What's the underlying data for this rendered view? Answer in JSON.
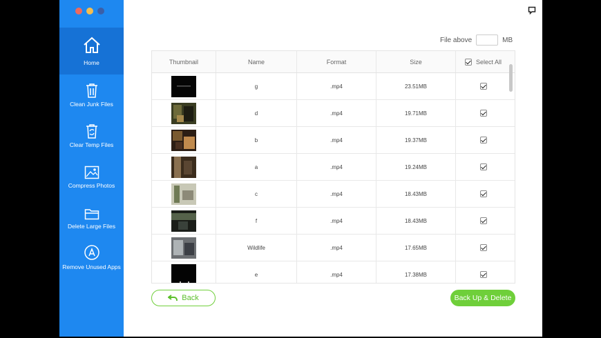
{
  "colors": {
    "sidebar": "#1e88f0",
    "sidebar_active": "#1672d6",
    "accent_green": "#6fcf3a"
  },
  "sidebar": {
    "items": [
      {
        "label": "Home",
        "icon": "home-icon"
      },
      {
        "label": "Clean Junk Files",
        "icon": "trash-icon"
      },
      {
        "label": "Clear Temp Files",
        "icon": "recycle-icon"
      },
      {
        "label": "Compress Photos",
        "icon": "photo-icon"
      },
      {
        "label": "Delete Large Files",
        "icon": "folder-icon"
      },
      {
        "label": "Remove Unused Apps",
        "icon": "app-store-icon"
      }
    ]
  },
  "filter": {
    "label": "File above",
    "value": "",
    "unit": "MB"
  },
  "table": {
    "headers": {
      "thumbnail": "Thumbnail",
      "name": "Name",
      "format": "Format",
      "size": "Size",
      "select_all": "Select All"
    },
    "rows": [
      {
        "name": "g",
        "format": ".mp4",
        "size": "23.51MB"
      },
      {
        "name": "d",
        "format": ".mp4",
        "size": "19.71MB"
      },
      {
        "name": "b",
        "format": ".mp4",
        "size": "19.37MB"
      },
      {
        "name": "a",
        "format": ".mp4",
        "size": "19.24MB"
      },
      {
        "name": "c",
        "format": ".mp4",
        "size": "18.43MB"
      },
      {
        "name": "f",
        "format": ".mp4",
        "size": "18.43MB"
      },
      {
        "name": "Wildlife",
        "format": ".mp4",
        "size": "17.65MB"
      },
      {
        "name": "e",
        "format": ".mp4",
        "size": "17.38MB"
      }
    ]
  },
  "buttons": {
    "back": "Back",
    "backup_delete": "Back Up & Delete"
  }
}
